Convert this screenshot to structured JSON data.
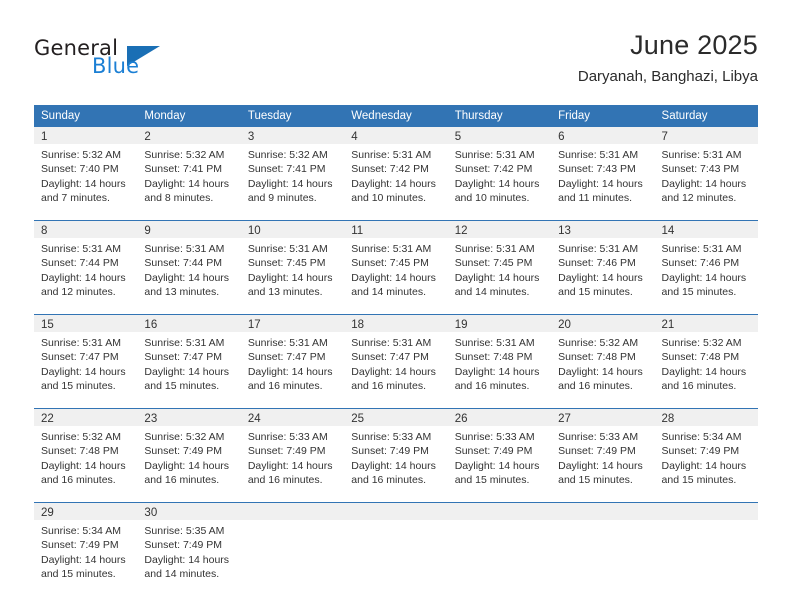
{
  "brand": {
    "name_part1": "General",
    "name_part2": "Blue",
    "triangle_color": "#1a6fb5",
    "blue_text_color": "#1b7fd4"
  },
  "header": {
    "title": "June 2025",
    "location": "Daryanah, Banghazi, Libya"
  },
  "theme": {
    "header_blue": "#3274b4",
    "day_band_gray": "#f0f0f0",
    "text_color": "#333333"
  },
  "weekdays": [
    "Sunday",
    "Monday",
    "Tuesday",
    "Wednesday",
    "Thursday",
    "Friday",
    "Saturday"
  ],
  "weeks": [
    [
      {
        "day": "1",
        "sunrise": "Sunrise: 5:32 AM",
        "sunset": "Sunset: 7:40 PM",
        "daylight1": "Daylight: 14 hours",
        "daylight2": "and 7 minutes."
      },
      {
        "day": "2",
        "sunrise": "Sunrise: 5:32 AM",
        "sunset": "Sunset: 7:41 PM",
        "daylight1": "Daylight: 14 hours",
        "daylight2": "and 8 minutes."
      },
      {
        "day": "3",
        "sunrise": "Sunrise: 5:32 AM",
        "sunset": "Sunset: 7:41 PM",
        "daylight1": "Daylight: 14 hours",
        "daylight2": "and 9 minutes."
      },
      {
        "day": "4",
        "sunrise": "Sunrise: 5:31 AM",
        "sunset": "Sunset: 7:42 PM",
        "daylight1": "Daylight: 14 hours",
        "daylight2": "and 10 minutes."
      },
      {
        "day": "5",
        "sunrise": "Sunrise: 5:31 AM",
        "sunset": "Sunset: 7:42 PM",
        "daylight1": "Daylight: 14 hours",
        "daylight2": "and 10 minutes."
      },
      {
        "day": "6",
        "sunrise": "Sunrise: 5:31 AM",
        "sunset": "Sunset: 7:43 PM",
        "daylight1": "Daylight: 14 hours",
        "daylight2": "and 11 minutes."
      },
      {
        "day": "7",
        "sunrise": "Sunrise: 5:31 AM",
        "sunset": "Sunset: 7:43 PM",
        "daylight1": "Daylight: 14 hours",
        "daylight2": "and 12 minutes."
      }
    ],
    [
      {
        "day": "8",
        "sunrise": "Sunrise: 5:31 AM",
        "sunset": "Sunset: 7:44 PM",
        "daylight1": "Daylight: 14 hours",
        "daylight2": "and 12 minutes."
      },
      {
        "day": "9",
        "sunrise": "Sunrise: 5:31 AM",
        "sunset": "Sunset: 7:44 PM",
        "daylight1": "Daylight: 14 hours",
        "daylight2": "and 13 minutes."
      },
      {
        "day": "10",
        "sunrise": "Sunrise: 5:31 AM",
        "sunset": "Sunset: 7:45 PM",
        "daylight1": "Daylight: 14 hours",
        "daylight2": "and 13 minutes."
      },
      {
        "day": "11",
        "sunrise": "Sunrise: 5:31 AM",
        "sunset": "Sunset: 7:45 PM",
        "daylight1": "Daylight: 14 hours",
        "daylight2": "and 14 minutes."
      },
      {
        "day": "12",
        "sunrise": "Sunrise: 5:31 AM",
        "sunset": "Sunset: 7:45 PM",
        "daylight1": "Daylight: 14 hours",
        "daylight2": "and 14 minutes."
      },
      {
        "day": "13",
        "sunrise": "Sunrise: 5:31 AM",
        "sunset": "Sunset: 7:46 PM",
        "daylight1": "Daylight: 14 hours",
        "daylight2": "and 15 minutes."
      },
      {
        "day": "14",
        "sunrise": "Sunrise: 5:31 AM",
        "sunset": "Sunset: 7:46 PM",
        "daylight1": "Daylight: 14 hours",
        "daylight2": "and 15 minutes."
      }
    ],
    [
      {
        "day": "15",
        "sunrise": "Sunrise: 5:31 AM",
        "sunset": "Sunset: 7:47 PM",
        "daylight1": "Daylight: 14 hours",
        "daylight2": "and 15 minutes."
      },
      {
        "day": "16",
        "sunrise": "Sunrise: 5:31 AM",
        "sunset": "Sunset: 7:47 PM",
        "daylight1": "Daylight: 14 hours",
        "daylight2": "and 15 minutes."
      },
      {
        "day": "17",
        "sunrise": "Sunrise: 5:31 AM",
        "sunset": "Sunset: 7:47 PM",
        "daylight1": "Daylight: 14 hours",
        "daylight2": "and 16 minutes."
      },
      {
        "day": "18",
        "sunrise": "Sunrise: 5:31 AM",
        "sunset": "Sunset: 7:47 PM",
        "daylight1": "Daylight: 14 hours",
        "daylight2": "and 16 minutes."
      },
      {
        "day": "19",
        "sunrise": "Sunrise: 5:31 AM",
        "sunset": "Sunset: 7:48 PM",
        "daylight1": "Daylight: 14 hours",
        "daylight2": "and 16 minutes."
      },
      {
        "day": "20",
        "sunrise": "Sunrise: 5:32 AM",
        "sunset": "Sunset: 7:48 PM",
        "daylight1": "Daylight: 14 hours",
        "daylight2": "and 16 minutes."
      },
      {
        "day": "21",
        "sunrise": "Sunrise: 5:32 AM",
        "sunset": "Sunset: 7:48 PM",
        "daylight1": "Daylight: 14 hours",
        "daylight2": "and 16 minutes."
      }
    ],
    [
      {
        "day": "22",
        "sunrise": "Sunrise: 5:32 AM",
        "sunset": "Sunset: 7:48 PM",
        "daylight1": "Daylight: 14 hours",
        "daylight2": "and 16 minutes."
      },
      {
        "day": "23",
        "sunrise": "Sunrise: 5:32 AM",
        "sunset": "Sunset: 7:49 PM",
        "daylight1": "Daylight: 14 hours",
        "daylight2": "and 16 minutes."
      },
      {
        "day": "24",
        "sunrise": "Sunrise: 5:33 AM",
        "sunset": "Sunset: 7:49 PM",
        "daylight1": "Daylight: 14 hours",
        "daylight2": "and 16 minutes."
      },
      {
        "day": "25",
        "sunrise": "Sunrise: 5:33 AM",
        "sunset": "Sunset: 7:49 PM",
        "daylight1": "Daylight: 14 hours",
        "daylight2": "and 16 minutes."
      },
      {
        "day": "26",
        "sunrise": "Sunrise: 5:33 AM",
        "sunset": "Sunset: 7:49 PM",
        "daylight1": "Daylight: 14 hours",
        "daylight2": "and 15 minutes."
      },
      {
        "day": "27",
        "sunrise": "Sunrise: 5:33 AM",
        "sunset": "Sunset: 7:49 PM",
        "daylight1": "Daylight: 14 hours",
        "daylight2": "and 15 minutes."
      },
      {
        "day": "28",
        "sunrise": "Sunrise: 5:34 AM",
        "sunset": "Sunset: 7:49 PM",
        "daylight1": "Daylight: 14 hours",
        "daylight2": "and 15 minutes."
      }
    ],
    [
      {
        "day": "29",
        "sunrise": "Sunrise: 5:34 AM",
        "sunset": "Sunset: 7:49 PM",
        "daylight1": "Daylight: 14 hours",
        "daylight2": "and 15 minutes."
      },
      {
        "day": "30",
        "sunrise": "Sunrise: 5:35 AM",
        "sunset": "Sunset: 7:49 PM",
        "daylight1": "Daylight: 14 hours",
        "daylight2": "and 14 minutes."
      },
      {
        "day": "",
        "sunrise": "",
        "sunset": "",
        "daylight1": "",
        "daylight2": ""
      },
      {
        "day": "",
        "sunrise": "",
        "sunset": "",
        "daylight1": "",
        "daylight2": ""
      },
      {
        "day": "",
        "sunrise": "",
        "sunset": "",
        "daylight1": "",
        "daylight2": ""
      },
      {
        "day": "",
        "sunrise": "",
        "sunset": "",
        "daylight1": "",
        "daylight2": ""
      },
      {
        "day": "",
        "sunrise": "",
        "sunset": "",
        "daylight1": "",
        "daylight2": ""
      }
    ]
  ]
}
